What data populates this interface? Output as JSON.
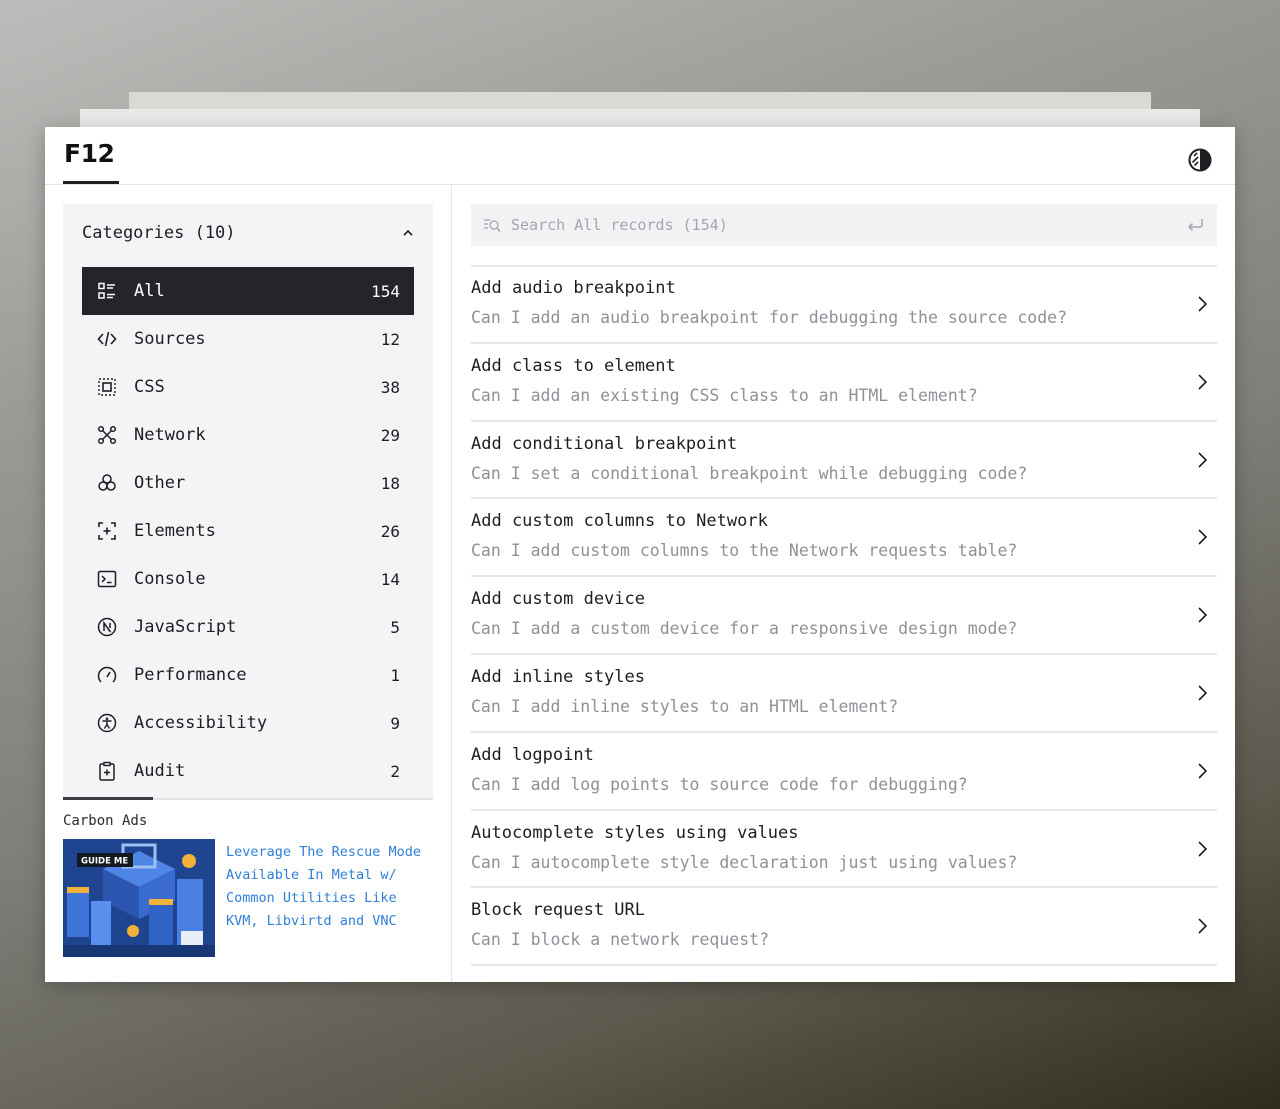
{
  "app": {
    "logo": "F12"
  },
  "header": {
    "theme_toggle_icon": "contrast-icon"
  },
  "sidebar": {
    "categories_title": "Categories (10)",
    "categories": [
      {
        "label": "All",
        "count": "154",
        "icon": "list-icon",
        "active": true
      },
      {
        "label": "Sources",
        "count": "12",
        "icon": "code-icon"
      },
      {
        "label": "CSS",
        "count": "38",
        "icon": "css-frame-icon"
      },
      {
        "label": "Network",
        "count": "29",
        "icon": "network-icon"
      },
      {
        "label": "Other",
        "count": "18",
        "icon": "circles-icon"
      },
      {
        "label": "Elements",
        "count": "26",
        "icon": "element-select-icon"
      },
      {
        "label": "Console",
        "count": "14",
        "icon": "terminal-icon"
      },
      {
        "label": "JavaScript",
        "count": "5",
        "icon": "javascript-icon"
      },
      {
        "label": "Performance",
        "count": "1",
        "icon": "gauge-icon"
      },
      {
        "label": "Accessibility",
        "count": "9",
        "icon": "accessibility-icon"
      },
      {
        "label": "Audit",
        "count": "2",
        "icon": "clipboard-icon"
      }
    ],
    "ads": {
      "title": "Carbon Ads",
      "image_label": "GUIDE ME",
      "text": "Leverage The Rescue Mode Available In Metal w/ Common Utilities Like KVM, Libvirtd and VNC"
    }
  },
  "search": {
    "placeholder": "Search All records (154)",
    "value": ""
  },
  "records": [
    {
      "title": "Add audio breakpoint",
      "desc": "Can I add an audio breakpoint for debugging the source code?"
    },
    {
      "title": "Add class to element",
      "desc": "Can I add an existing CSS class to an HTML element?"
    },
    {
      "title": "Add conditional breakpoint",
      "desc": "Can I set a conditional breakpoint while debugging code?"
    },
    {
      "title": "Add custom columns to Network",
      "desc": "Can I add custom columns to the Network requests table?"
    },
    {
      "title": "Add custom device",
      "desc": "Can I add a custom device for a responsive design mode?"
    },
    {
      "title": "Add inline styles",
      "desc": "Can I add inline styles to an HTML element?"
    },
    {
      "title": "Add logpoint",
      "desc": "Can I add log points to source code for debugging?"
    },
    {
      "title": "Autocomplete styles using values",
      "desc": "Can I autocomplete style declaration just using values?"
    },
    {
      "title": "Block request URL",
      "desc": "Can I block a network request?"
    }
  ],
  "colors": {
    "active_bg": "#24252b",
    "panel_bg": "#f3f4f6",
    "link": "#2f7fd8",
    "muted_text": "#8e9198"
  }
}
